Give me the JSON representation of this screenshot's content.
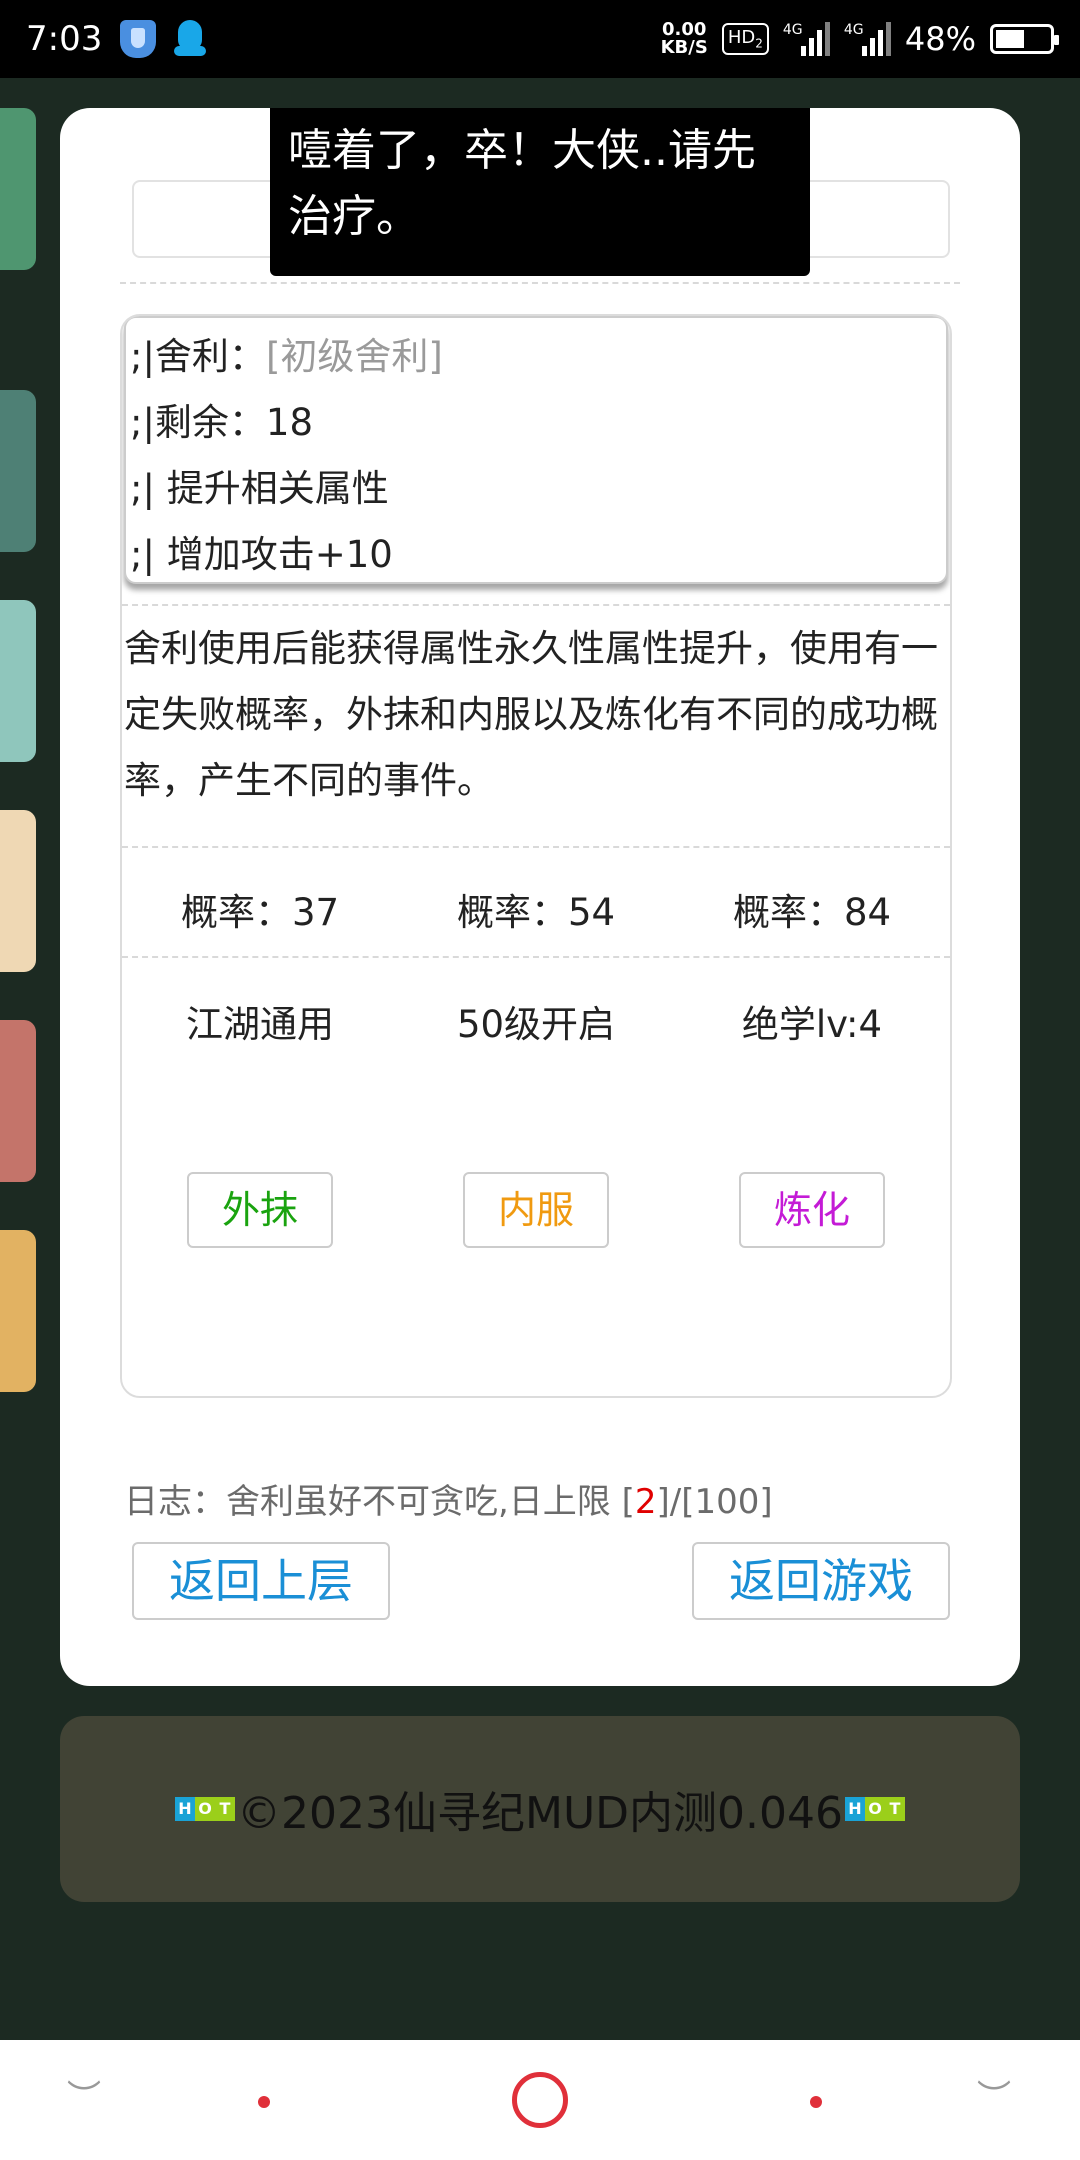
{
  "status_bar": {
    "time": "7:03",
    "net_speed_value": "0.00",
    "net_speed_unit": "KB/S",
    "hd_label": "HD",
    "hd_sub": "2",
    "signal1_label": "4G",
    "signal2_label": "4G",
    "battery": "48%",
    "battery_level": 0.48
  },
  "side_tab_colors": [
    "#4f9670",
    "#4e8075",
    "#8fc6bc",
    "#efd8b4",
    "#c4746a",
    "#e2b262"
  ],
  "toast": {
    "text": "噎着了，卒！大侠..请先治疗。"
  },
  "info_box": {
    "line1_prefix": ";|舍利：",
    "line1_value": "[初级舍利]",
    "line2": ";|剩余：18",
    "line3": ";| 提升相关属性",
    "line4": ";| 增加攻击+10"
  },
  "description": "舍利使用后能获得属性永久性属性提升，使用有一定失败概率，外抹和内服以及炼化有不同的成功概率，产生不同的事件。",
  "probabilities": [
    "概率：37",
    "概率：54",
    "概率：84"
  ],
  "requirements": [
    "江湖通用",
    "50级开启",
    "绝学lv:4"
  ],
  "actions": [
    {
      "label": "外抹",
      "color": "#1aa30f"
    },
    {
      "label": "内服",
      "color": "#f09a10"
    },
    {
      "label": "炼化",
      "color": "#c41bd6"
    }
  ],
  "log": {
    "prefix": "日志：舍利虽好不可贪吃,日上限 [",
    "count": "2",
    "suffix": "]/[100]"
  },
  "buttons": {
    "back_upper": "返回上层",
    "back_game": "返回游戏"
  },
  "footer": {
    "text": "©2023仙寻纪MUD内测0.046",
    "badge": "HOT"
  }
}
